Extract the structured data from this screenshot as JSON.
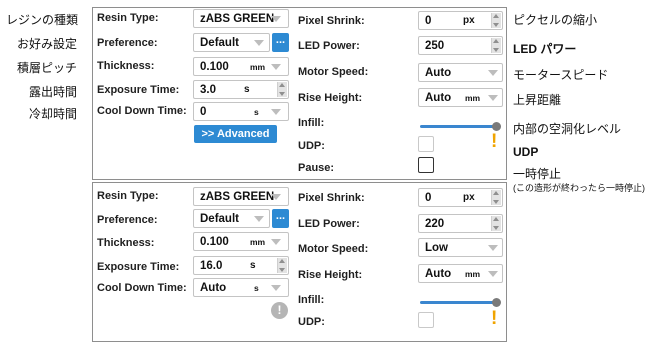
{
  "left_notes": [
    "レジンの種類",
    "お好み設定",
    "積層ピッチ",
    "露出時間",
    "冷却時間"
  ],
  "right_notes": {
    "pixel_shrink": "ピクセルの縮小",
    "led_power": "LED パワー",
    "motor_speed": "モータースピード",
    "rise_height": "上昇距離",
    "infill": "内部の空洞化レベル",
    "udp": "UDP",
    "pause": "一時停止",
    "pause_sub": "(この造形が終わったら一時停止)"
  },
  "labels": {
    "resin_type": "Resin Type:",
    "preference": "Preference:",
    "thickness": "Thickness:",
    "exposure_time": "Exposure Time:",
    "cool_down_time": "Cool Down Time:",
    "pixel_shrink": "Pixel Shrink:",
    "led_power": "LED Power:",
    "motor_speed": "Motor Speed:",
    "rise_height": "Rise Height:",
    "infill": "Infill:",
    "udp": "UDP:",
    "pause": "Pause:"
  },
  "panel1": {
    "resin_type": "zABS GREEN",
    "preference": "Default",
    "more_button": "...",
    "thickness": "0.100",
    "thickness_unit": "mm",
    "exposure_time": "3.0",
    "exposure_unit": "s",
    "cool_down_time": "0",
    "cool_down_unit": "s",
    "advanced_button": ">> Advanced",
    "pixel_shrink": "0",
    "pixel_shrink_unit": "px",
    "led_power": "250",
    "motor_speed": "Auto",
    "rise_height": "Auto",
    "rise_height_unit": "mm",
    "infill_level": 1.0,
    "udp_checked": false,
    "pause_checked": false,
    "warning_icon": "!"
  },
  "panel2": {
    "resin_type": "zABS GREEN",
    "preference": "Default",
    "more_button": "...",
    "thickness": "0.100",
    "thickness_unit": "mm",
    "exposure_time": "16.0",
    "exposure_unit": "s",
    "cool_down_time": "Auto",
    "cool_down_unit": "s",
    "info_icon": "!",
    "pixel_shrink": "0",
    "pixel_shrink_unit": "px",
    "led_power": "220",
    "motor_speed": "Low",
    "rise_height": "Auto",
    "rise_height_unit": "mm",
    "infill_level": 1.0,
    "udp_checked": false,
    "warning_icon": "!"
  }
}
